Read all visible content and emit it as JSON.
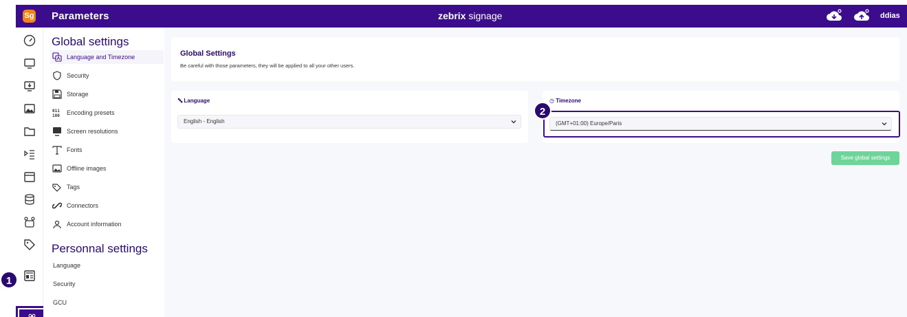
{
  "app": {
    "logo_text": "Sg",
    "title": "Parameters",
    "brand_bold": "zebrix",
    "brand_rest": " signage",
    "user": "ddias"
  },
  "colors": {
    "primary": "#3b0d8c",
    "logo": "#f0831d",
    "save": "#6fd49a"
  },
  "rail": {
    "icons": [
      "dashboard-icon",
      "screen-icon",
      "screen-download-icon",
      "media-icon",
      "folder-icon",
      "playlist-icon",
      "calendar-icon",
      "database-icon",
      "widgets-icon",
      "tag-icon",
      "news-icon",
      "settings-icon"
    ]
  },
  "menu": {
    "global_heading": "Global settings",
    "items": [
      {
        "label": "Language and Timezone",
        "icon": "translate-icon"
      },
      {
        "label": "Security",
        "icon": "shield-icon"
      },
      {
        "label": "Storage",
        "icon": "floppy-icon"
      },
      {
        "label": "Encoding presets",
        "icon": "binary-icon"
      },
      {
        "label": "Screen resolutions",
        "icon": "monitor-icon"
      },
      {
        "label": "Fonts",
        "icon": "font-icon"
      },
      {
        "label": "Offline images",
        "icon": "image-icon"
      },
      {
        "label": "Tags",
        "icon": "tags-icon"
      },
      {
        "label": "Connectors",
        "icon": "link-icon"
      },
      {
        "label": "Account information",
        "icon": "account-icon"
      }
    ],
    "personal_heading": "Personnal settings",
    "personal_items": [
      "Language",
      "Security",
      "GCU"
    ]
  },
  "main": {
    "title": "Global Settings",
    "subtitle": "Be careful with those parameters, they will be applied to all your other users.",
    "language_label": "Language",
    "language_value": "English - English",
    "timezone_label": "Timezone",
    "timezone_value": "(GMT+01:00) Europe/Paris",
    "save_label": "Save global settings"
  },
  "annotations": {
    "badge1": "1",
    "badge2": "2"
  }
}
